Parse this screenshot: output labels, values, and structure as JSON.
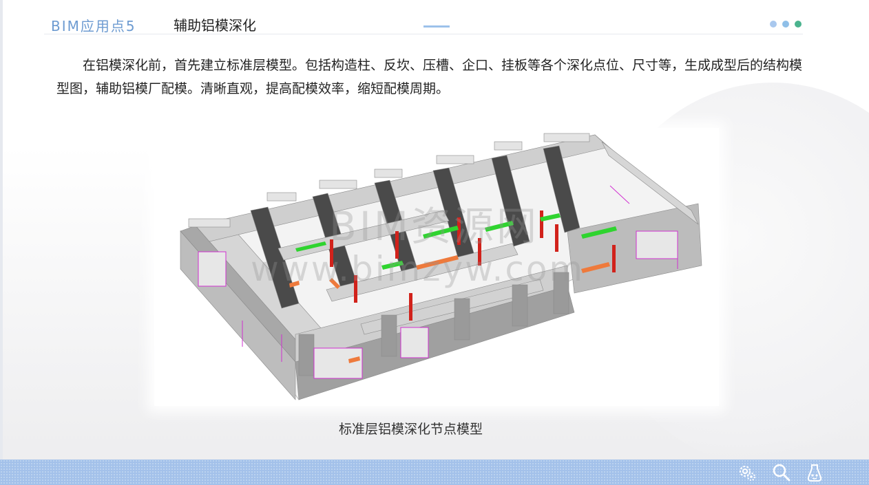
{
  "header": {
    "section_label": "BIM应用点5",
    "title": "辅助铝模深化",
    "dot_colors": [
      "#a9c8ee",
      "#8fbfe8",
      "#4bb38e"
    ]
  },
  "description": "在铝模深化前，首先建立标准层模型。包括构造柱、反坎、压槽、企口、挂板等各个深化点位、尺寸等，生成成型后的结构模型图，辅助铝模厂配模。清晰直观，提高配模效率，缩短配模周期。",
  "figure": {
    "caption": "标准层铝模深化节点模型",
    "watermark_line1": "BIM资源网",
    "watermark_line2": "www.bimzyw.com",
    "colors": {
      "wall_top": "#d6d6d6",
      "wall_side": "#a8a8a8",
      "wall_dark": "#4a4a4a",
      "column": "#d1221b",
      "beam_green": "#2fd42f",
      "orange": "#ee7a3c",
      "magenta": "#d12fd1"
    }
  },
  "footer": {
    "icons": [
      "settings-gears-icon",
      "search-icon",
      "assistant-icon"
    ],
    "background": "#a3c1ea"
  }
}
